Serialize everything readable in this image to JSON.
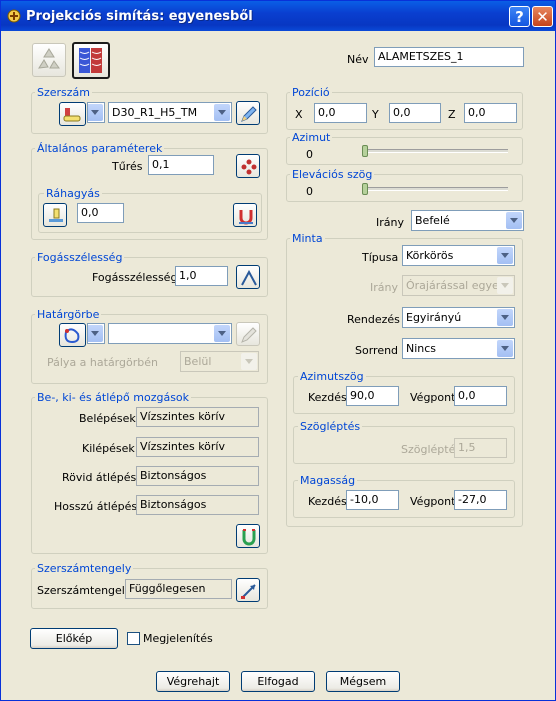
{
  "window": {
    "title": "Projekciós simítás: egyenesből"
  },
  "nev": {
    "label": "Név",
    "value": "ALAMETSZES_1"
  },
  "szerszam": {
    "group": "Szerszám",
    "tool_value": "D30_R1_H5_TM"
  },
  "altalanos": {
    "group": "Általános paraméterek",
    "tures_label": "Tűrés",
    "tures_value": "0,1",
    "rahagyas_group": "Ráhagyás",
    "rahagyas_value": "0,0"
  },
  "fogas": {
    "group": "Fogásszélesség",
    "label": "Fogásszélesség",
    "value": "1,0"
  },
  "hatargorbe": {
    "group": "Határgörbe",
    "palya_label": "Pálya a határgörbén",
    "palya_value": "Belül"
  },
  "mozgasok": {
    "group": "Be-, ki- és átlépő mozgások",
    "rows": [
      {
        "label": "Belépések",
        "value": "Vízszintes körív"
      },
      {
        "label": "Kilépések",
        "value": "Vízszintes körív"
      },
      {
        "label": "Rövid átlépés",
        "value": "Biztonságos"
      },
      {
        "label": "Hosszú átlépés",
        "value": "Biztonságos"
      }
    ]
  },
  "tengely": {
    "group": "Szerszámtengely",
    "label": "Szerszámtengely",
    "value": "Függőlegesen"
  },
  "pozicio": {
    "group": "Pozíció",
    "x_label": "X",
    "x_value": "0,0",
    "y_label": "Y",
    "y_value": "0,0",
    "z_label": "Z",
    "z_value": "0,0"
  },
  "azimut": {
    "group": "Azimut",
    "value": "0",
    "slider_level": 0
  },
  "elevacio": {
    "group": "Elevációs szög",
    "value": "0",
    "slider_level": 0
  },
  "irany": {
    "label": "Irány",
    "value": "Befelé"
  },
  "minta": {
    "group": "Minta",
    "tipusa_label": "Típusa",
    "tipusa_value": "Körkörös",
    "irany_label": "Irány",
    "irany_value": "Órajárással egyező",
    "rendezes_label": "Rendezés",
    "rendezes_value": "Egyirányú",
    "sorrend_label": "Sorrend",
    "sorrend_value": "Nincs",
    "azimutszog_group": "Azimutszög",
    "kezdes_label": "Kezdés",
    "kezdes_value": "90,0",
    "vegpont_label": "Végpont",
    "vegpont_value": "0,0",
    "szoglepes_group": "Szögléptés",
    "szoglepes_label": "Szögléptés",
    "szoglepes_value": "1,5",
    "magassag_group": "Magasság",
    "m_kezdes_label": "Kezdés",
    "m_kezdes_value": "-10,0",
    "m_vegpont_label": "Végpont",
    "m_vegpont_value": "-27,0"
  },
  "bottom": {
    "elokep": "Előkép",
    "megjelenites": "Megjelenítés",
    "vegrehajt": "Végrehajt",
    "elfogad": "Elfogad",
    "megsem": "Mégsem"
  },
  "icons": {
    "title": "app-icon",
    "recycle": "recycle-icon",
    "toolpath": "toolpath-pattern-icon",
    "tool": "tool-icon",
    "edit": "edit-pencil-icon",
    "tolerance": "tolerance-icon",
    "thickness": "thickness-icon",
    "thickness_tool": "thickness-tool-icon",
    "stepover": "stepover-icon",
    "boundary": "boundary-icon",
    "leads": "leads-links-icon",
    "axis": "tool-axis-icon"
  }
}
